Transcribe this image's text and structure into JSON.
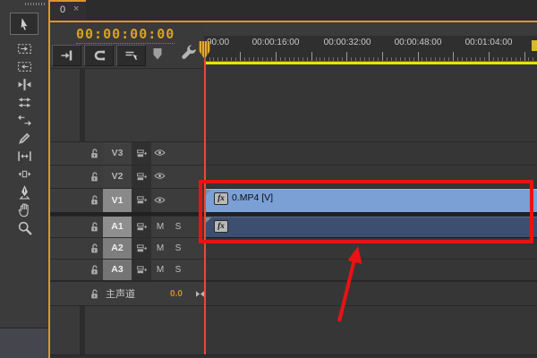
{
  "tab": {
    "title": "0",
    "close": "×"
  },
  "timecode": "00:00:00:00",
  "toolbar": {
    "buttons": [
      {
        "name": "insert-overwrite-nest-button",
        "icon": "nest-icon"
      },
      {
        "name": "snap-button",
        "icon": "magnet-icon"
      },
      {
        "name": "linked-selection-button",
        "icon": "linked-selection-icon"
      }
    ],
    "marker": {
      "name": "add-marker-button",
      "icon": "marker-icon"
    },
    "settings": {
      "name": "timeline-settings-button",
      "icon": "wrench-icon"
    }
  },
  "tools": [
    {
      "name": "selection-tool",
      "icon": "cursor-icon",
      "active": true
    },
    {
      "name": "track-select-forward-tool",
      "icon": "track-forward-icon"
    },
    {
      "name": "track-select-backward-tool",
      "icon": "track-backward-icon"
    },
    {
      "name": "ripple-edit-tool",
      "icon": "ripple-icon"
    },
    {
      "name": "rolling-edit-tool",
      "icon": "rolling-icon"
    },
    {
      "name": "rate-stretch-tool",
      "icon": "rate-stretch-icon"
    },
    {
      "name": "razor-tool",
      "icon": "razor-icon"
    },
    {
      "name": "slip-tool",
      "icon": "slip-icon"
    },
    {
      "name": "slide-tool",
      "icon": "slide-icon"
    },
    {
      "name": "pen-tool",
      "icon": "pen-icon"
    },
    {
      "name": "hand-tool",
      "icon": "hand-icon"
    },
    {
      "name": "zoom-tool",
      "icon": "magnifier-icon"
    }
  ],
  "ruler": {
    "labels": [
      "00:00",
      "00:00:16:00",
      "00:00:32:00",
      "00:00:48:00",
      "00:01:04:00"
    ]
  },
  "tracks": [
    {
      "id": "V3",
      "kind": "video",
      "targeted": false
    },
    {
      "id": "V2",
      "kind": "video",
      "targeted": false
    },
    {
      "id": "V1",
      "kind": "video",
      "targeted": true
    },
    {
      "id": "A1",
      "kind": "audio",
      "targeted": true,
      "mute": "M",
      "solo": "S"
    },
    {
      "id": "A2",
      "kind": "audio",
      "targeted": true,
      "mute": "M",
      "solo": "S"
    },
    {
      "id": "A3",
      "kind": "audio",
      "targeted": true,
      "mute": "M",
      "solo": "S"
    }
  ],
  "master": {
    "label": "主声道",
    "value": "0.0"
  },
  "clips": [
    {
      "track": "V1",
      "type": "video",
      "badge": "fx",
      "label": "0.MP4 [V]"
    },
    {
      "track": "A1",
      "type": "audio",
      "badge": "fx",
      "label": ""
    }
  ],
  "colors": {
    "accent_orange": "#dd9626",
    "timecode_orange": "#d9a125",
    "workarea_yellow": "#eae300",
    "playhead_red": "#e84b30",
    "annotation_red": "#ea1212",
    "video_clip_blue": "#7aa0d6",
    "audio_clip_navy": "#3d4f70"
  },
  "annotations": {
    "highlight": "red-rectangle-around-clips",
    "pointer": "red-arrow"
  }
}
